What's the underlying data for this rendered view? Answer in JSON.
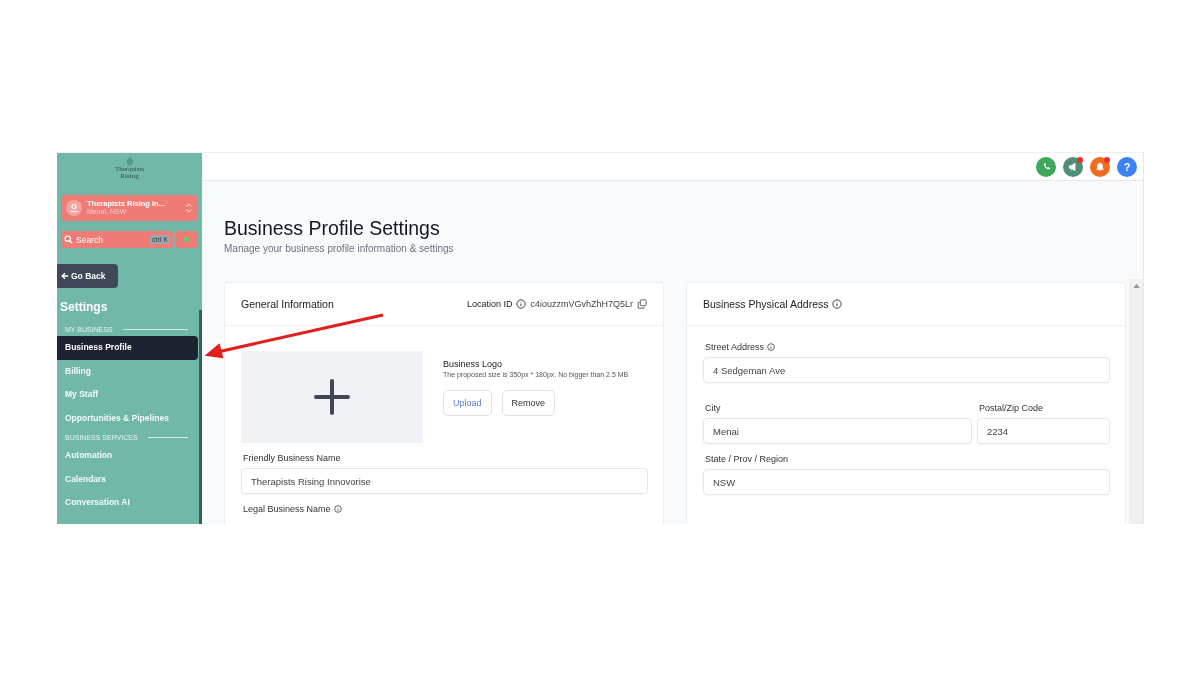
{
  "sidebar": {
    "logo": "Therapists Rising",
    "account": {
      "name": "Therapists Rising In...",
      "location": "Menai, NSW"
    },
    "search": {
      "placeholder": "Search",
      "shortcut": "ctrl K"
    },
    "go_back": "Go Back",
    "heading": "Settings",
    "sections": [
      {
        "title": "MY BUSINESS",
        "items": [
          {
            "label": "Business Profile",
            "selected": true
          },
          {
            "label": "Billing",
            "selected": false
          },
          {
            "label": "My Staff",
            "selected": false
          },
          {
            "label": "Opportunities & Pipelines",
            "selected": false
          }
        ]
      },
      {
        "title": "BUSINESS SERVICES",
        "items": [
          {
            "label": "Automation",
            "selected": false
          },
          {
            "label": "Calendars",
            "selected": false
          },
          {
            "label": "Conversation AI",
            "selected": false
          }
        ]
      }
    ]
  },
  "header_icons": [
    {
      "kind": "phone",
      "color": "#3fa75a",
      "badge": false
    },
    {
      "kind": "megaphone",
      "color": "#4f8f78",
      "badge": true
    },
    {
      "kind": "bell",
      "color": "#f26b1d",
      "badge": true
    },
    {
      "kind": "help",
      "color": "#3b82f6",
      "badge": false,
      "text": "?"
    }
  ],
  "page": {
    "title": "Business Profile Settings",
    "subtitle": "Manage your business profile information & settings"
  },
  "general": {
    "title": "General Information",
    "location_label": "Location ID",
    "location_id": "c4iouzzmVGvhZhH7Q5Lr",
    "logo": {
      "title": "Business Logo",
      "hint": "The proposed size is 350px * 180px. No bigger than 2.5 MB",
      "upload": "Upload",
      "remove": "Remove"
    },
    "friendly_name": {
      "label": "Friendly Business Name",
      "value": "Therapists Rising Innovorise"
    },
    "legal_name_label": "Legal Business Name"
  },
  "address": {
    "title": "Business Physical Address",
    "street": {
      "label": "Street Address",
      "value": "4 Sedgeman Ave"
    },
    "city": {
      "label": "City",
      "value": "Menai"
    },
    "postal": {
      "label": "Postal/Zip Code",
      "value": "2234"
    },
    "state": {
      "label": "State / Prov / Region",
      "value": "NSW"
    }
  }
}
